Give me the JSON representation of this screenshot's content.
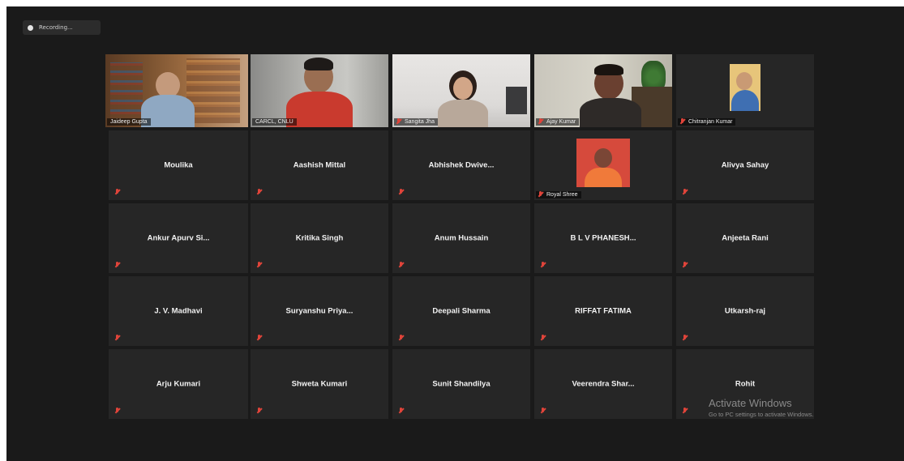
{
  "recording": {
    "label": "Recording..."
  },
  "video_participants": [
    {
      "name": "Jaideep Gupta"
    },
    {
      "name": "CARCL, CNLU"
    },
    {
      "name": "Sangita Jha"
    },
    {
      "name": "Ajay Kumar"
    },
    {
      "name": "Chitranjan Kumar"
    }
  ],
  "grid": [
    [
      "Moulika",
      "Aashish Mittal",
      "Abhishek  Dwive...",
      "Royal Shree",
      "Alivya Sahay"
    ],
    [
      "Ankur Apurv Si...",
      "Kritika Singh",
      "Anum Hussain",
      "B L V PHANESH...",
      "Anjeeta Rani"
    ],
    [
      "J. V. Madhavi",
      "Suryanshu  Priya...",
      "Deepali Sharma",
      "RIFFAT FATIMA",
      "Utkarsh-raj"
    ],
    [
      "Arju Kumari",
      "Shweta Kumari",
      "Sunit Shandilya",
      "Veerendra  Shar...",
      "Rohit"
    ]
  ],
  "watermark": {
    "title": "Activate Windows",
    "subtitle": "Go to PC settings to activate Windows."
  },
  "colors": {
    "active_speaker_border": "#a8cf3b",
    "muted_mic": "#e0443a",
    "tile_bg": "#262626"
  },
  "icons": [
    "recording-dot-icon",
    "muted-mic-icon"
  ]
}
